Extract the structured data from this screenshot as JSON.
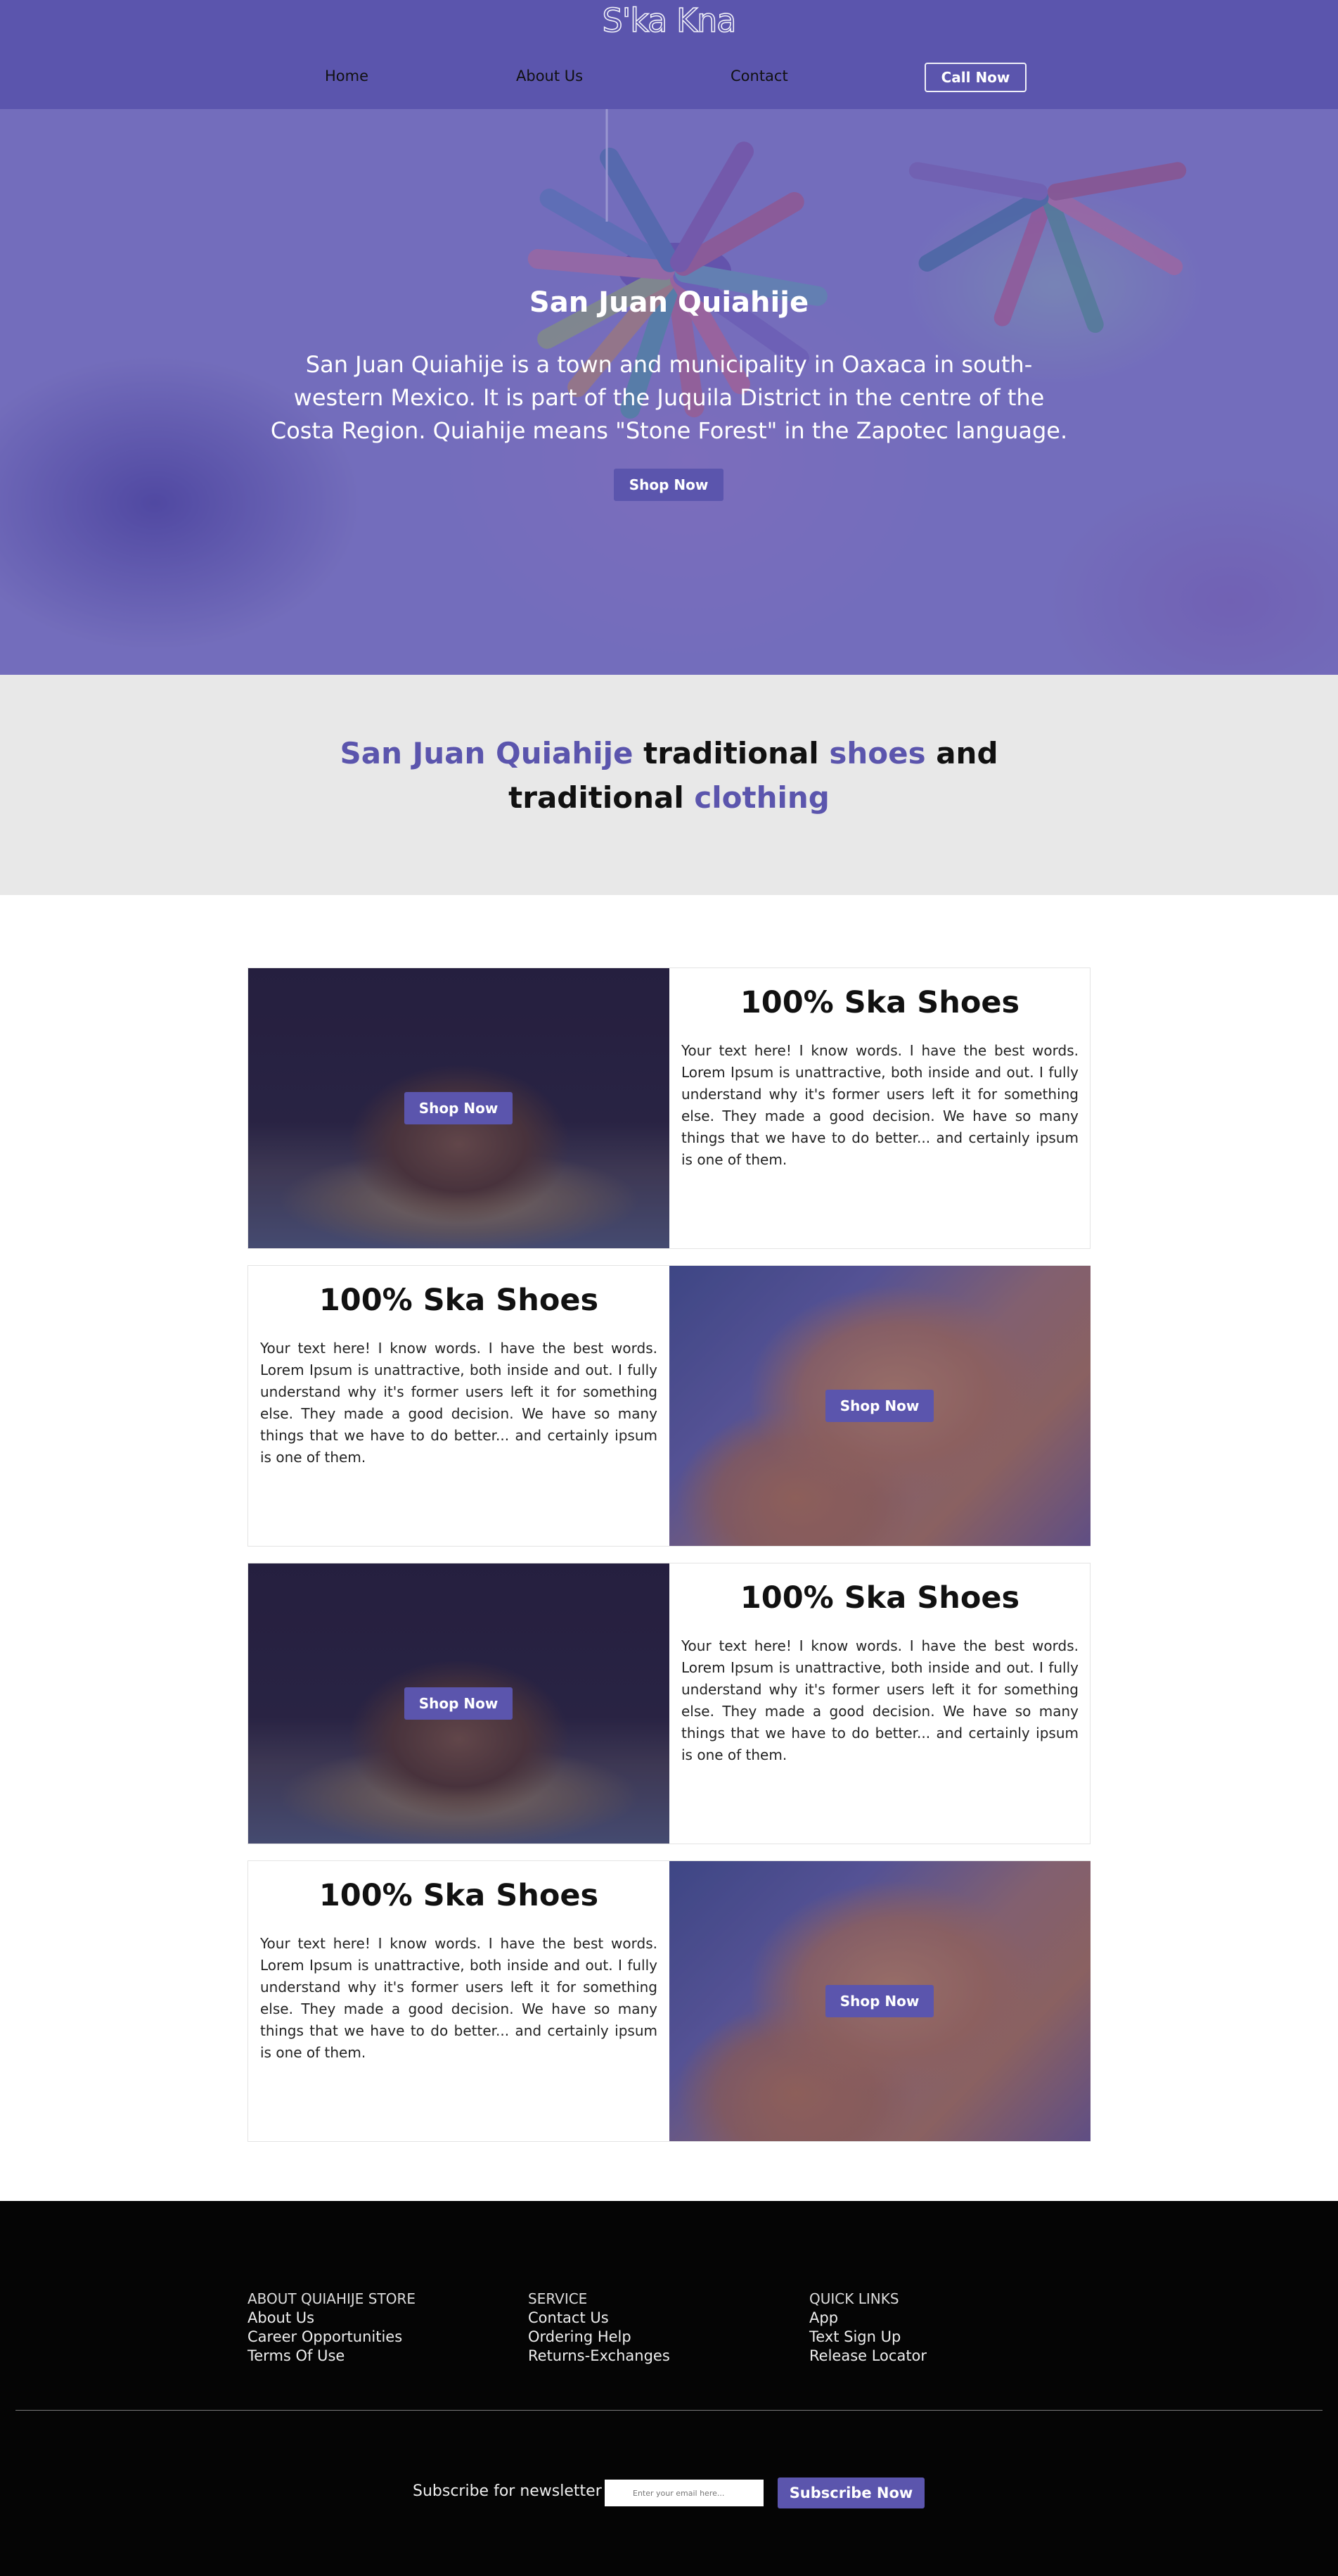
{
  "header": {
    "logo": "S'ka Kna",
    "nav": [
      "Home",
      "About Us",
      "Contact"
    ],
    "call_button": "Call Now"
  },
  "hero": {
    "title": "San Juan Quiahije",
    "text": "San Juan Quiahije is a town and municipality in Oaxaca in south-western Mexico. It is part of the Juquila District in the centre of the Costa Region. Quiahije means \"Stone Forest\" in the Zapotec language.",
    "button": "Shop Now"
  },
  "banner": {
    "part1": "San Juan Quiahije",
    "part2": " traditional ",
    "part3": "shoes",
    "part4": " and traditional ",
    "part5": "clothing"
  },
  "cards": [
    {
      "title": "100% Ska Shoes",
      "text": "Your text here! I know words. I have the best words. Lorem Ipsum is unattractive, both inside and out. I fully understand why it's former users left it for something else. They made a good decision. We have so many things that we have to do better... and certainly ipsum is one of them.",
      "button": "Shop Now",
      "image": "brown-work-boot"
    },
    {
      "title": "100% Ska Shoes",
      "text": "Your text here! I know words. I have the best words. Lorem Ipsum is unattractive, both inside and out. I fully understand why it's former users left it for something else. They made a good decision. We have so many things that we have to do better... and certainly ipsum is one of them.",
      "button": "Shop Now",
      "image": "woven-leather-shoes"
    },
    {
      "title": "100% Ska Shoes",
      "text": "Your text here! I know words. I have the best words. Lorem Ipsum is unattractive, both inside and out. I fully understand why it's former users left it for something else. They made a good decision. We have so many things that we have to do better... and certainly ipsum is one of them.",
      "button": "Shop Now",
      "image": "brown-work-boot"
    },
    {
      "title": "100% Ska Shoes",
      "text": "Your text here! I know words. I have the best words. Lorem Ipsum is unattractive, both inside and out. I fully understand why it's former users left it for something else. They made a good decision. We have so many things that we have to do better... and certainly ipsum is one of them.",
      "button": "Shop Now",
      "image": "woven-leather-shoes"
    }
  ],
  "footer": {
    "columns": [
      {
        "heading": "ABOUT QUIAHIJE STORE",
        "links": [
          "About Us",
          "Career Opportunities",
          "Terms Of Use"
        ]
      },
      {
        "heading": "SERVICE",
        "links": [
          "Contact Us",
          "Ordering Help",
          "Returns-Exchanges"
        ]
      },
      {
        "heading": "QUICK LINKS",
        "links": [
          "App",
          "Text Sign Up",
          "Release Locator"
        ]
      }
    ],
    "newsletter_label": "Subscribe for newsletter",
    "email_placeholder": "Enter your email here...",
    "subscribe_button": "Subscribe Now"
  },
  "colors": {
    "brand": "#5b55ad",
    "banner_bg": "#e8e8e8",
    "footer_bg": "#050505"
  }
}
